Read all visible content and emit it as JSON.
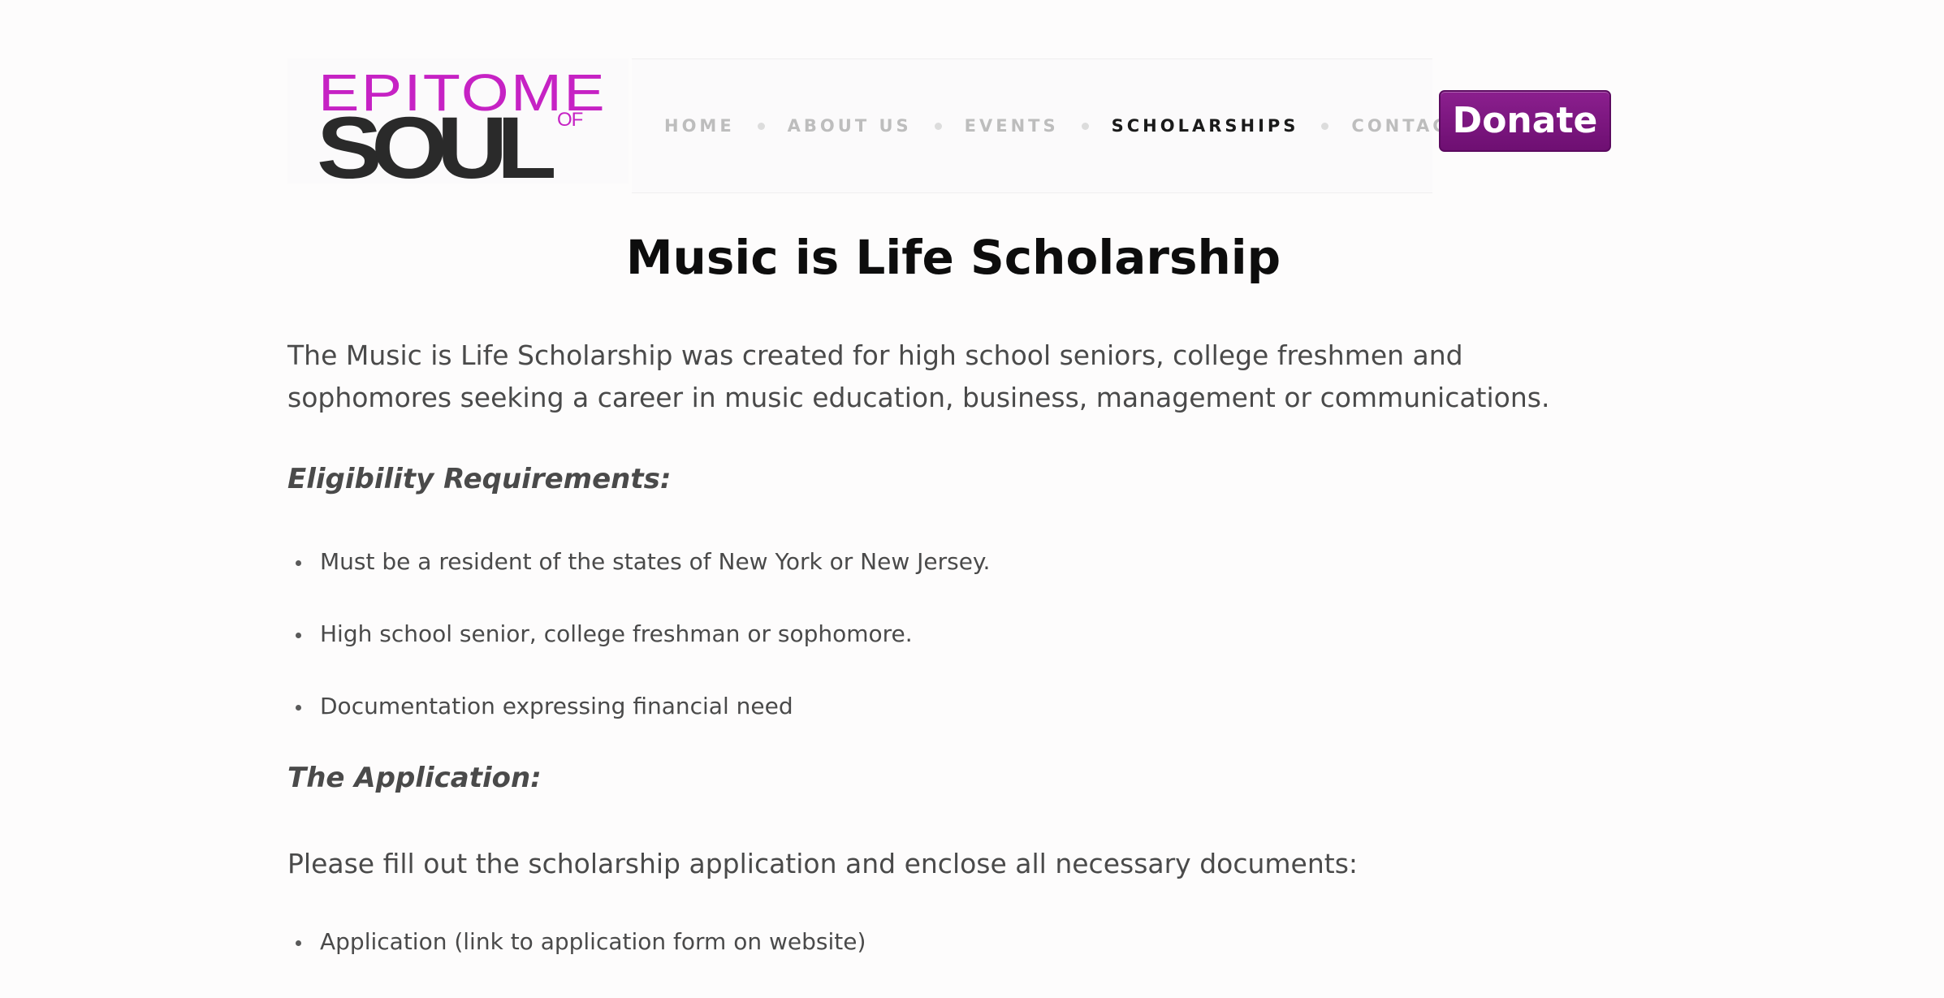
{
  "brand": {
    "logo_top": "EPITOME",
    "logo_bottom": "SOUL",
    "logo_of": "OF"
  },
  "nav": {
    "items": [
      {
        "label": "HOME"
      },
      {
        "label": "ABOUT US"
      },
      {
        "label": "EVENTS"
      },
      {
        "label": "SCHOLARSHIPS",
        "active": true
      },
      {
        "label": "CONTACT"
      }
    ]
  },
  "donate": {
    "label": "Donate"
  },
  "content": {
    "title": "Music is Life Scholarship",
    "intro": "The Music is Life Scholarship was created for high school seniors, college freshmen and sophomores seeking a career in music education, business, management or communications.",
    "eligibility_heading": "Eligibility Requirements:",
    "eligibility": [
      "Must be a resident of the states of New York or New Jersey.",
      "High school senior, college freshman or sophomore.",
      "Documentation expressing financial need"
    ],
    "application_heading": "The Application:",
    "application_intro": "Please fill out the scholarship application and enclose all necessary documents:",
    "application_items": [
      "Application (link to application form on website)"
    ]
  },
  "colors": {
    "accent": "#c622c4",
    "donate": "#7a1580",
    "nav_active": "#1a1a1a",
    "nav_inactive": "#bdbdbd"
  }
}
